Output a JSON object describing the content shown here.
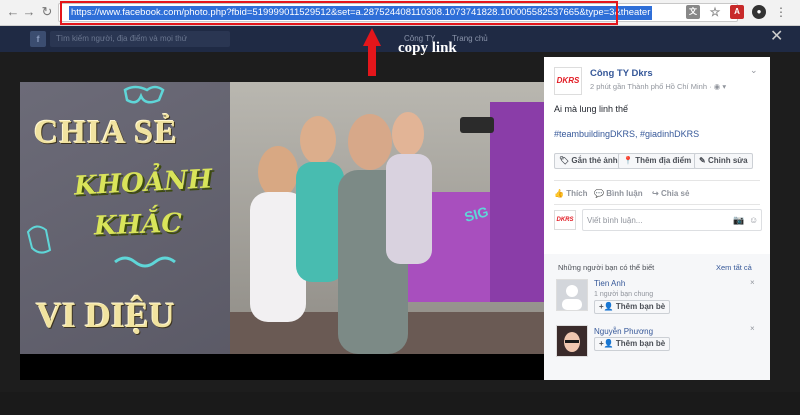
{
  "browser": {
    "url": "https://www.facebook.com/photo.php?fbid=519999011529512&set=a.287524408110308.1073741828.100005582537665&type=3&theater",
    "icons": [
      "back-icon",
      "forward-icon",
      "reload-icon",
      "lock-icon",
      "translate-icon",
      "star-icon",
      "pdf-icon",
      "extension-icon",
      "menu-icon"
    ]
  },
  "fb_header": {
    "search_placeholder": "Tìm kiếm người, địa điểm và mọi thứ",
    "user": "Công TY",
    "home": "Trang chủ"
  },
  "annotation": {
    "label": "copy link"
  },
  "photo": {
    "line1": "CHIA SẺ",
    "line2": "KHOẢNH",
    "line3": "KHẮC",
    "line4": "VI DIỆU"
  },
  "post": {
    "page_name": "Công TY Dkrs",
    "meta": "2 phút gần Thành phố Hồ Chí Minh · ",
    "caption": "Ai mà lung linh thế",
    "hashtags": "#teambuildingDKRS, #giadinhDKRS",
    "logo_text": "DKRS",
    "actions": [
      "Gắn thẻ ảnh",
      "Thêm địa điểm",
      "Chỉnh sửa"
    ],
    "social": [
      "Thích",
      "Bình luận",
      "Chia sẻ"
    ],
    "comment_placeholder": "Viết bình luận..."
  },
  "suggestions": {
    "title": "Những người bạn có thể biết",
    "see_all": "Xem tất cả",
    "people": [
      {
        "name": "Tien Anh",
        "mutual": "1 người bạn chung",
        "button": "Thêm bạn bè"
      },
      {
        "name": "Nguyễn Phương",
        "mutual": "",
        "button": "Thêm bạn bè"
      }
    ]
  },
  "colors": {
    "url_highlight": "#2f6fd8",
    "annotation_red": "#e4161b",
    "fb_blue": "#365899",
    "brand_red": "#e21b23"
  }
}
